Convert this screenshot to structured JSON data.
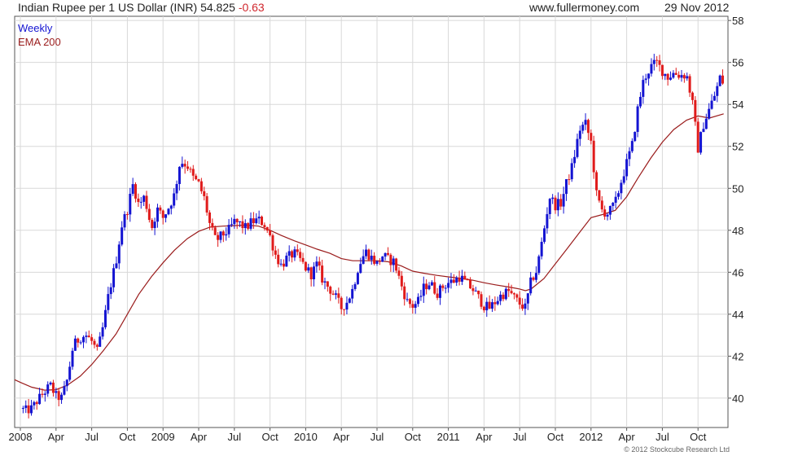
{
  "header": {
    "title": "Indian Rupee per 1 US Dollar (INR) 54.825",
    "change": "-0.63",
    "site": "www.fullermoney.com",
    "date": "29 Nov 2012"
  },
  "copyright": "© 2012 Stockcube Research Ltd",
  "colors": {
    "up": "#1414d2",
    "down": "#e01b1b",
    "ema": "#9a1c1c",
    "grid": "#d8d8d8",
    "frame": "#555555"
  },
  "chart_data": {
    "type": "candlestick",
    "title": "Indian Rupee per 1 US Dollar (INR) 54.825",
    "legend": [
      {
        "name": "Weekly",
        "color": "#1414d2"
      },
      {
        "name": "EMA 200",
        "color": "#9a1c1c"
      }
    ],
    "ylim": [
      38.6,
      58.2
    ],
    "y_ticks": [
      40,
      42,
      44,
      46,
      48,
      50,
      52,
      54,
      56,
      58
    ],
    "x_range": [
      2007.96,
      2012.96
    ],
    "x_ticks": [
      {
        "label": "2008",
        "t": 2008.0
      },
      {
        "label": "Apr",
        "t": 2008.25
      },
      {
        "label": "Jul",
        "t": 2008.5
      },
      {
        "label": "Oct",
        "t": 2008.75
      },
      {
        "label": "2009",
        "t": 2009.0
      },
      {
        "label": "Apr",
        "t": 2009.25
      },
      {
        "label": "Jul",
        "t": 2009.5
      },
      {
        "label": "Oct",
        "t": 2009.75
      },
      {
        "label": "2010",
        "t": 2010.0
      },
      {
        "label": "Apr",
        "t": 2010.25
      },
      {
        "label": "Jul",
        "t": 2010.5
      },
      {
        "label": "Oct",
        "t": 2010.75
      },
      {
        "label": "2011",
        "t": 2011.0
      },
      {
        "label": "Apr",
        "t": 2011.25
      },
      {
        "label": "Jul",
        "t": 2011.5
      },
      {
        "label": "Oct",
        "t": 2011.75
      },
      {
        "label": "2012",
        "t": 2012.0
      },
      {
        "label": "Apr",
        "t": 2012.25
      },
      {
        "label": "Jul",
        "t": 2012.5
      },
      {
        "label": "Oct",
        "t": 2012.75
      }
    ],
    "close_path": [
      [
        2008.0,
        39.5
      ],
      [
        2008.04,
        39.4
      ],
      [
        2008.08,
        39.5
      ],
      [
        2008.12,
        39.9
      ],
      [
        2008.17,
        40.3
      ],
      [
        2008.21,
        40.6
      ],
      [
        2008.25,
        40.1
      ],
      [
        2008.29,
        40.0
      ],
      [
        2008.33,
        40.9
      ],
      [
        2008.37,
        42.5
      ],
      [
        2008.42,
        42.9
      ],
      [
        2008.46,
        43.0
      ],
      [
        2008.5,
        42.7
      ],
      [
        2008.54,
        42.2
      ],
      [
        2008.58,
        43.4
      ],
      [
        2008.62,
        45.0
      ],
      [
        2008.67,
        46.5
      ],
      [
        2008.71,
        48.2
      ],
      [
        2008.75,
        49.0
      ],
      [
        2008.79,
        50.2
      ],
      [
        2008.83,
        49.2
      ],
      [
        2008.87,
        49.6
      ],
      [
        2008.92,
        48.1
      ],
      [
        2008.96,
        49.0
      ],
      [
        2009.0,
        48.6
      ],
      [
        2009.04,
        49.1
      ],
      [
        2009.08,
        49.7
      ],
      [
        2009.12,
        51.3
      ],
      [
        2009.17,
        51.1
      ],
      [
        2009.21,
        50.5
      ],
      [
        2009.25,
        50.2
      ],
      [
        2009.29,
        49.5
      ],
      [
        2009.33,
        48.2
      ],
      [
        2009.37,
        47.5
      ],
      [
        2009.42,
        47.8
      ],
      [
        2009.46,
        48.0
      ],
      [
        2009.5,
        48.4
      ],
      [
        2009.54,
        48.3
      ],
      [
        2009.58,
        48.1
      ],
      [
        2009.62,
        48.4
      ],
      [
        2009.67,
        48.5
      ],
      [
        2009.71,
        48.3
      ],
      [
        2009.75,
        47.7
      ],
      [
        2009.79,
        46.8
      ],
      [
        2009.83,
        46.3
      ],
      [
        2009.87,
        46.7
      ],
      [
        2009.92,
        46.9
      ],
      [
        2009.96,
        46.6
      ],
      [
        2010.0,
        46.2
      ],
      [
        2010.04,
        45.9
      ],
      [
        2010.08,
        46.4
      ],
      [
        2010.12,
        45.6
      ],
      [
        2010.17,
        45.2
      ],
      [
        2010.21,
        44.8
      ],
      [
        2010.25,
        44.3
      ],
      [
        2010.29,
        44.6
      ],
      [
        2010.33,
        45.2
      ],
      [
        2010.37,
        46.3
      ],
      [
        2010.42,
        47.0
      ],
      [
        2010.46,
        46.7
      ],
      [
        2010.5,
        46.4
      ],
      [
        2010.54,
        46.8
      ],
      [
        2010.58,
        46.6
      ],
      [
        2010.62,
        46.5
      ],
      [
        2010.67,
        45.4
      ],
      [
        2010.71,
        44.6
      ],
      [
        2010.75,
        44.4
      ],
      [
        2010.79,
        44.6
      ],
      [
        2010.83,
        45.3
      ],
      [
        2010.87,
        45.5
      ],
      [
        2010.92,
        45.0
      ],
      [
        2010.96,
        45.3
      ],
      [
        2011.0,
        45.5
      ],
      [
        2011.04,
        45.6
      ],
      [
        2011.08,
        45.8
      ],
      [
        2011.12,
        45.5
      ],
      [
        2011.17,
        45.2
      ],
      [
        2011.21,
        44.8
      ],
      [
        2011.25,
        44.4
      ],
      [
        2011.29,
        44.3
      ],
      [
        2011.33,
        44.6
      ],
      [
        2011.37,
        44.9
      ],
      [
        2011.42,
        45.1
      ],
      [
        2011.46,
        44.8
      ],
      [
        2011.5,
        44.5
      ],
      [
        2011.54,
        44.3
      ],
      [
        2011.58,
        45.6
      ],
      [
        2011.62,
        46.1
      ],
      [
        2011.67,
        48.0
      ],
      [
        2011.71,
        49.6
      ],
      [
        2011.75,
        49.2
      ],
      [
        2011.79,
        49.3
      ],
      [
        2011.83,
        50.3
      ],
      [
        2011.87,
        51.1
      ],
      [
        2011.92,
        52.8
      ],
      [
        2011.96,
        53.1
      ],
      [
        2012.0,
        52.2
      ],
      [
        2012.04,
        49.6
      ],
      [
        2012.08,
        48.9
      ],
      [
        2012.12,
        48.8
      ],
      [
        2012.17,
        49.3
      ],
      [
        2012.21,
        50.3
      ],
      [
        2012.25,
        51.2
      ],
      [
        2012.29,
        52.1
      ],
      [
        2012.33,
        53.9
      ],
      [
        2012.37,
        55.2
      ],
      [
        2012.42,
        55.8
      ],
      [
        2012.46,
        56.0
      ],
      [
        2012.5,
        55.6
      ],
      [
        2012.54,
        55.3
      ],
      [
        2012.58,
        55.5
      ],
      [
        2012.62,
        55.4
      ],
      [
        2012.67,
        55.4
      ],
      [
        2012.71,
        54.1
      ],
      [
        2012.75,
        51.9
      ],
      [
        2012.79,
        53.1
      ],
      [
        2012.83,
        53.8
      ],
      [
        2012.87,
        54.5
      ],
      [
        2012.91,
        55.4
      ],
      [
        2012.93,
        54.9
      ]
    ],
    "ema_200": [
      [
        2007.96,
        40.88
      ],
      [
        2008.0,
        40.75
      ],
      [
        2008.08,
        40.52
      ],
      [
        2008.17,
        40.38
      ],
      [
        2008.25,
        40.4
      ],
      [
        2008.33,
        40.62
      ],
      [
        2008.42,
        41.05
      ],
      [
        2008.5,
        41.6
      ],
      [
        2008.58,
        42.25
      ],
      [
        2008.67,
        43.05
      ],
      [
        2008.75,
        44.0
      ],
      [
        2008.83,
        44.95
      ],
      [
        2008.92,
        45.8
      ],
      [
        2009.0,
        46.45
      ],
      [
        2009.08,
        47.05
      ],
      [
        2009.17,
        47.6
      ],
      [
        2009.25,
        47.95
      ],
      [
        2009.33,
        48.15
      ],
      [
        2009.42,
        48.2
      ],
      [
        2009.5,
        48.22
      ],
      [
        2009.58,
        48.25
      ],
      [
        2009.67,
        48.2
      ],
      [
        2009.75,
        48.0
      ],
      [
        2009.83,
        47.75
      ],
      [
        2009.92,
        47.5
      ],
      [
        2010.0,
        47.3
      ],
      [
        2010.08,
        47.1
      ],
      [
        2010.17,
        46.9
      ],
      [
        2010.25,
        46.65
      ],
      [
        2010.33,
        46.55
      ],
      [
        2010.42,
        46.55
      ],
      [
        2010.5,
        46.55
      ],
      [
        2010.58,
        46.5
      ],
      [
        2010.67,
        46.3
      ],
      [
        2010.75,
        46.05
      ],
      [
        2010.83,
        45.95
      ],
      [
        2010.92,
        45.85
      ],
      [
        2011.0,
        45.78
      ],
      [
        2011.08,
        45.72
      ],
      [
        2011.17,
        45.62
      ],
      [
        2011.25,
        45.5
      ],
      [
        2011.33,
        45.4
      ],
      [
        2011.42,
        45.3
      ],
      [
        2011.5,
        45.2
      ],
      [
        2011.54,
        45.12
      ],
      [
        2011.58,
        45.2
      ],
      [
        2011.67,
        45.7
      ],
      [
        2011.75,
        46.4
      ],
      [
        2011.83,
        47.1
      ],
      [
        2011.92,
        47.9
      ],
      [
        2012.0,
        48.6
      ],
      [
        2012.08,
        48.75
      ],
      [
        2012.17,
        48.95
      ],
      [
        2012.25,
        49.6
      ],
      [
        2012.33,
        50.5
      ],
      [
        2012.42,
        51.45
      ],
      [
        2012.5,
        52.2
      ],
      [
        2012.58,
        52.8
      ],
      [
        2012.67,
        53.25
      ],
      [
        2012.75,
        53.45
      ],
      [
        2012.83,
        53.35
      ],
      [
        2012.93,
        53.55
      ]
    ]
  }
}
